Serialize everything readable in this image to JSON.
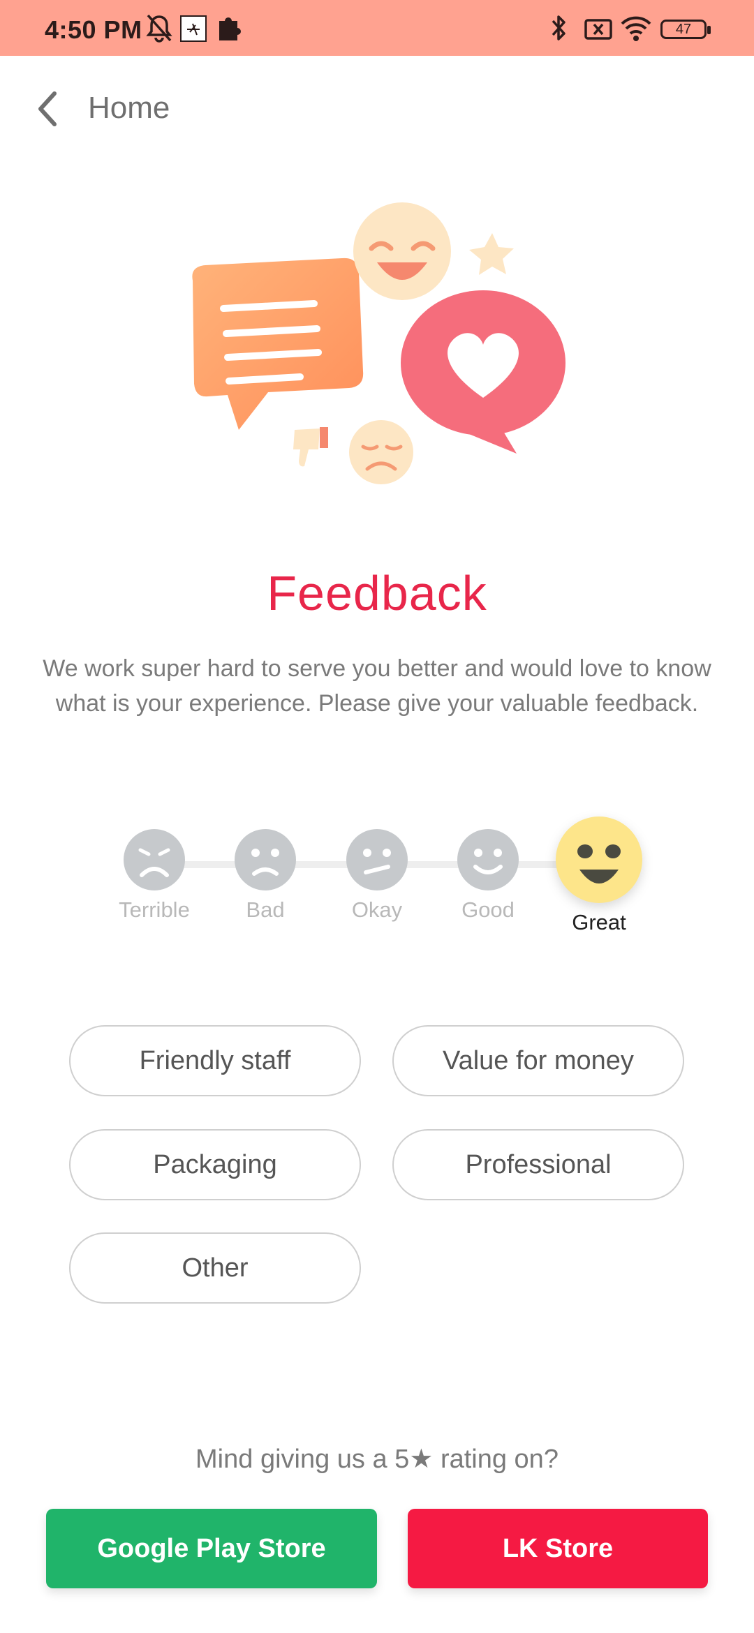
{
  "status_bar": {
    "time": "4:50 PM",
    "battery": "47",
    "color": "#ffa290"
  },
  "nav": {
    "back_label": "Home"
  },
  "feedback": {
    "title": "Feedback",
    "description": "We work super hard to serve you better and would love to know what is your experience. Please give your valuable feedback."
  },
  "rating": {
    "options": [
      {
        "label": "Terrible"
      },
      {
        "label": "Bad"
      },
      {
        "label": "Okay"
      },
      {
        "label": "Good"
      },
      {
        "label": "Great"
      }
    ],
    "selected": "Great"
  },
  "chips": [
    {
      "label": "Friendly staff"
    },
    {
      "label": "Value for money"
    },
    {
      "label": "Packaging"
    },
    {
      "label": "Professional"
    },
    {
      "label": "Other"
    }
  ],
  "store_prompt": "Mind giving us a 5★ rating on?",
  "stores": {
    "google_label": "Google Play Store",
    "google_color": "#20b46a",
    "lk_label": "LK Store",
    "lk_color": "#f51a43"
  },
  "colors": {
    "accent": "#e8264a",
    "face_inactive": "#c6c9cc",
    "face_active": "#fde58a"
  }
}
